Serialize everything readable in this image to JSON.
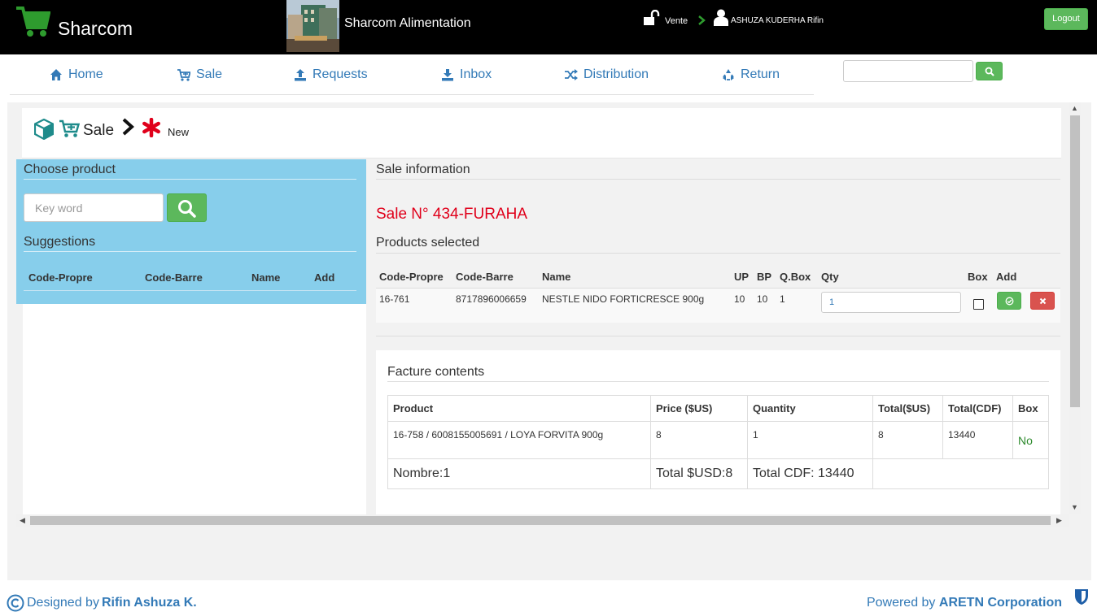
{
  "header": {
    "brand": "Sharcom",
    "store_name": "Sharcom Alimentation",
    "mode": "Vente",
    "user": "ASHUZA KUDERHA Rifin",
    "logout": "Logout"
  },
  "nav": {
    "items": [
      {
        "label": "Home",
        "icon": "home-icon"
      },
      {
        "label": "Sale",
        "icon": "cart-icon"
      },
      {
        "label": "Requests",
        "icon": "upload-icon"
      },
      {
        "label": "Inbox",
        "icon": "download-icon"
      },
      {
        "label": "Distribution",
        "icon": "shuffle-icon"
      },
      {
        "label": "Return",
        "icon": "recycle-icon"
      }
    ],
    "search_value": ""
  },
  "breadcrumb": {
    "section": "Sale",
    "page": "New"
  },
  "choose_product": {
    "title": "Choose product",
    "keyword_placeholder": "Key word",
    "suggestions_title": "Suggestions",
    "columns": [
      "Code-Propre",
      "Code-Barre",
      "Name",
      "Add"
    ]
  },
  "sale_info": {
    "title": "Sale information",
    "sale_number": "Sale N° 434-FURAHA",
    "products_title": "Products selected",
    "columns": [
      "Code-Propre",
      "Code-Barre",
      "Name",
      "UP",
      "BP",
      "Q.Box",
      "Qty",
      "Box",
      "Add"
    ],
    "rows": [
      {
        "code_propre": "16-761",
        "code_barre": "8717896006659",
        "name": "NESTLE NIDO FORTICRESCE 900g",
        "up": "10",
        "bp": "10",
        "qbox": "1",
        "qty": "1",
        "box": false
      }
    ]
  },
  "facture": {
    "title": "Facture contents",
    "columns": [
      "Product",
      "Price ($US)",
      "Quantity",
      "Total($US)",
      "Total(CDF)",
      "Box"
    ],
    "rows": [
      {
        "product": "16-758 / 6008155005691 / LOYA FORVITA 900g",
        "price": "8",
        "quantity": "1",
        "total_usd": "8",
        "total_cdf": "13440",
        "box": "No"
      }
    ],
    "summary": {
      "count": "Nombre:1",
      "total_usd": "Total $USD:8",
      "total_cdf": "Total CDF: 13440"
    }
  },
  "footer": {
    "designed_prefix": "Designed by",
    "designer": "Rifin Ashuza K.",
    "powered_prefix": "Powered by",
    "company": "ARETN Corporation"
  },
  "colors": {
    "accent": "#337ab7",
    "success": "#5cb85c",
    "danger": "#d9534f",
    "sale_red": "#e0001b",
    "panel": "#87ceeb"
  }
}
